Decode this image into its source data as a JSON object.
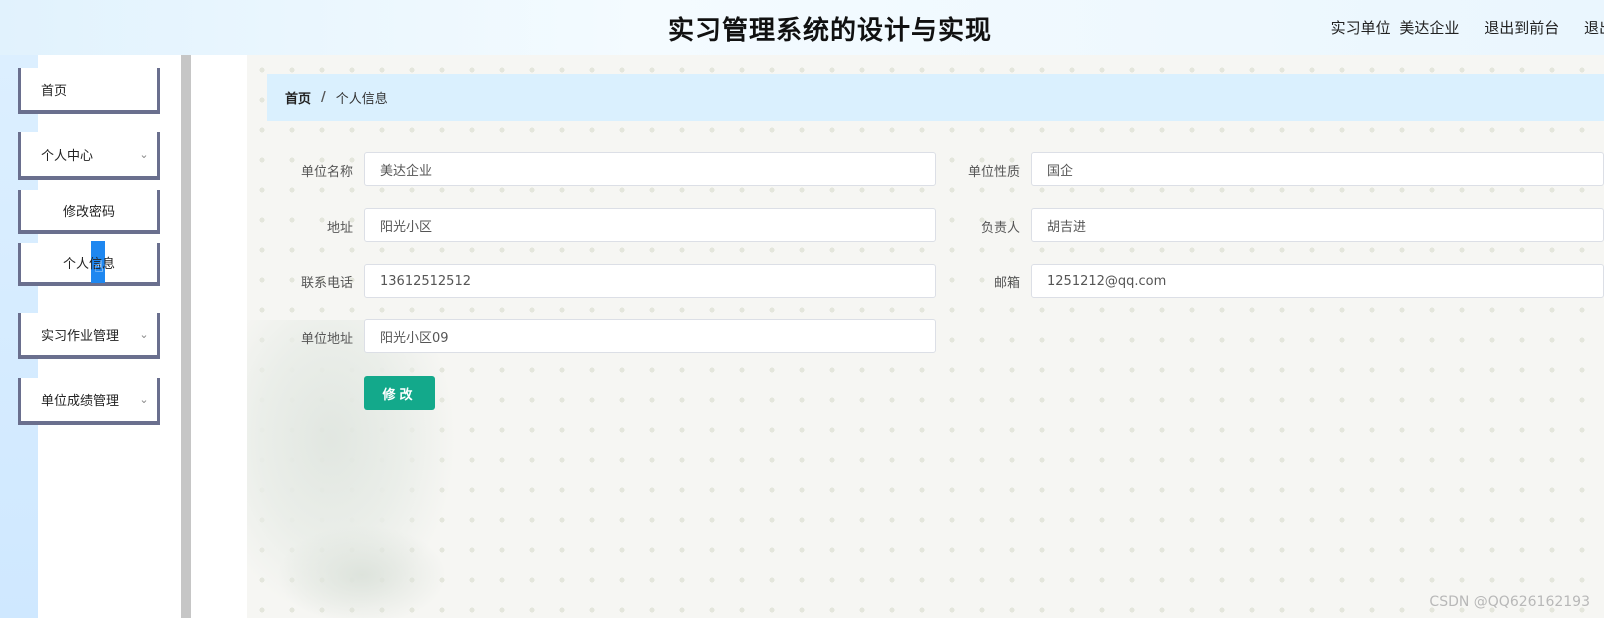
{
  "header": {
    "title": "实习管理系统的设计与实现",
    "user_role": "实习单位",
    "user_name": "美达企业",
    "to_front": "退出到前台",
    "logout": "退出登录"
  },
  "sidebar": {
    "items": [
      {
        "label": "首页"
      },
      {
        "label": "个人中心",
        "icon": "chevron-down-icon"
      },
      {
        "label": "修改密码"
      },
      {
        "label": "个人信息"
      },
      {
        "label": "实习作业管理",
        "icon": "chevron-down-icon"
      },
      {
        "label": "单位成绩管理",
        "icon": "chevron-down-icon"
      }
    ]
  },
  "breadcrumb": {
    "home": "首页",
    "separator": "/",
    "current": "个人信息"
  },
  "form": {
    "unit_name": {
      "label": "单位名称",
      "value": "美达企业"
    },
    "unit_type": {
      "label": "单位性质",
      "value": "国企"
    },
    "address": {
      "label": "地址",
      "value": "阳光小区"
    },
    "manager": {
      "label": "负责人",
      "value": "胡吉进"
    },
    "phone": {
      "label": "联系电话",
      "value": "13612512512"
    },
    "email": {
      "label": "邮箱",
      "value": "1251212@qq.com"
    },
    "unit_address": {
      "label": "单位地址",
      "value": "阳光小区09"
    },
    "submit_label": "修改"
  },
  "watermark": "CSDN @QQ626162193",
  "colors": {
    "accent": "#13a98b",
    "breadcrumb_bg": "#daf0fe",
    "menu_border": "#6a6f8e"
  }
}
